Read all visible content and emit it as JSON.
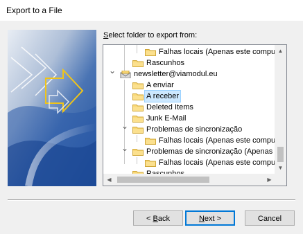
{
  "window": {
    "title": "Export to a File"
  },
  "prompt": {
    "label_pre": "",
    "label_access": "S",
    "label_post": "elect folder to export from:"
  },
  "tree": {
    "items": [
      {
        "label": "Falhas locais (Apenas este computador)",
        "indent": 2,
        "expander": "none",
        "icon": "folder-icon",
        "selected": false
      },
      {
        "label": "Rascunhos",
        "indent": 1,
        "expander": "none",
        "icon": "folder-icon",
        "selected": false
      },
      {
        "label": "newsletter@viamodul.eu",
        "indent": 0,
        "expander": "collapse",
        "icon": "mailbox-icon",
        "selected": false
      },
      {
        "label": "A enviar",
        "indent": 1,
        "expander": "none",
        "icon": "folder-icon",
        "selected": false
      },
      {
        "label": "A receber",
        "indent": 1,
        "expander": "none",
        "icon": "folder-icon",
        "selected": true
      },
      {
        "label": "Deleted Items",
        "indent": 1,
        "expander": "none",
        "icon": "folder-icon",
        "selected": false
      },
      {
        "label": "Junk E-Mail",
        "indent": 1,
        "expander": "none",
        "icon": "folder-icon",
        "selected": false
      },
      {
        "label": "Problemas de sincronização",
        "indent": 1,
        "expander": "collapse",
        "icon": "folder-icon",
        "selected": false
      },
      {
        "label": "Falhas locais (Apenas este computador)",
        "indent": 2,
        "expander": "none",
        "icon": "folder-icon",
        "selected": false
      },
      {
        "label": "Problemas de sincronização (Apenas este computador)",
        "indent": 1,
        "expander": "collapse",
        "icon": "folder-icon",
        "selected": false
      },
      {
        "label": "Falhas locais (Apenas este computador)",
        "indent": 2,
        "expander": "none",
        "icon": "folder-icon",
        "selected": false
      },
      {
        "label": "Rascunhos",
        "indent": 1,
        "expander": "none",
        "icon": "folder-icon",
        "selected": false
      }
    ]
  },
  "buttons": {
    "back": {
      "pre": "< ",
      "access": "B",
      "post": "ack"
    },
    "next": {
      "pre": "",
      "access": "N",
      "post": "ext >"
    },
    "cancel": {
      "label": "Cancel"
    }
  },
  "colors": {
    "selection": "#cce8ff",
    "default_button_border": "#0078d7",
    "folder": "#f8d775"
  }
}
